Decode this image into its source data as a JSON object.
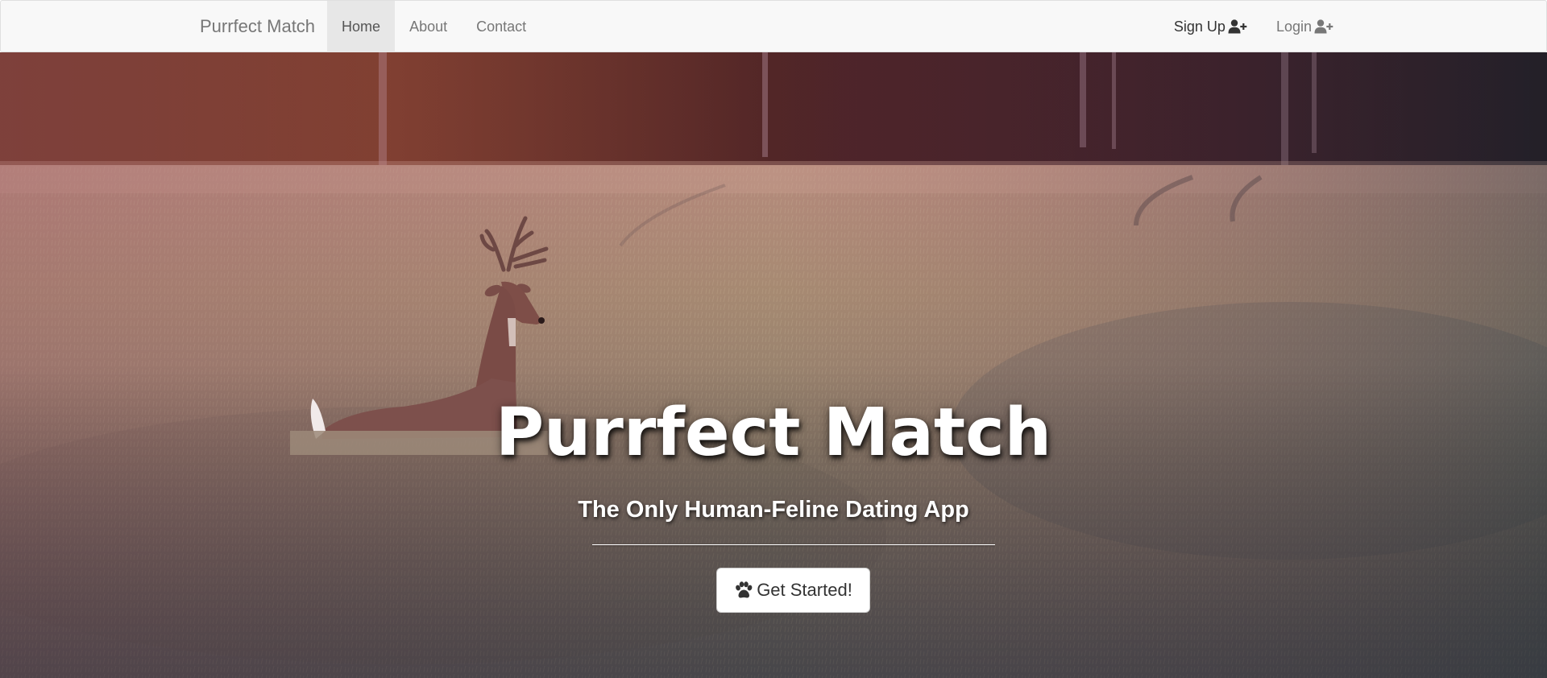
{
  "navbar": {
    "brand": "Purrfect Match",
    "links": [
      {
        "label": "Home",
        "active": true
      },
      {
        "label": "About",
        "active": false
      },
      {
        "label": "Contact",
        "active": false
      }
    ],
    "right_links": [
      {
        "label": "Sign Up",
        "icon": "user-plus-icon"
      },
      {
        "label": "Login",
        "icon": "user-plus-icon"
      }
    ]
  },
  "hero": {
    "title": "Purrfect Match",
    "subtitle": "The Only Human-Feline Dating App",
    "cta": {
      "label": "Get Started!",
      "icon": "paw-icon"
    },
    "background": "photo of a deer standing in a wheat field at sunset"
  },
  "colors": {
    "navbar_bg": "#f8f8f8",
    "active_tab_bg": "#e7e7e7",
    "nav_text": "#777777",
    "hero_text": "#ffffff"
  }
}
